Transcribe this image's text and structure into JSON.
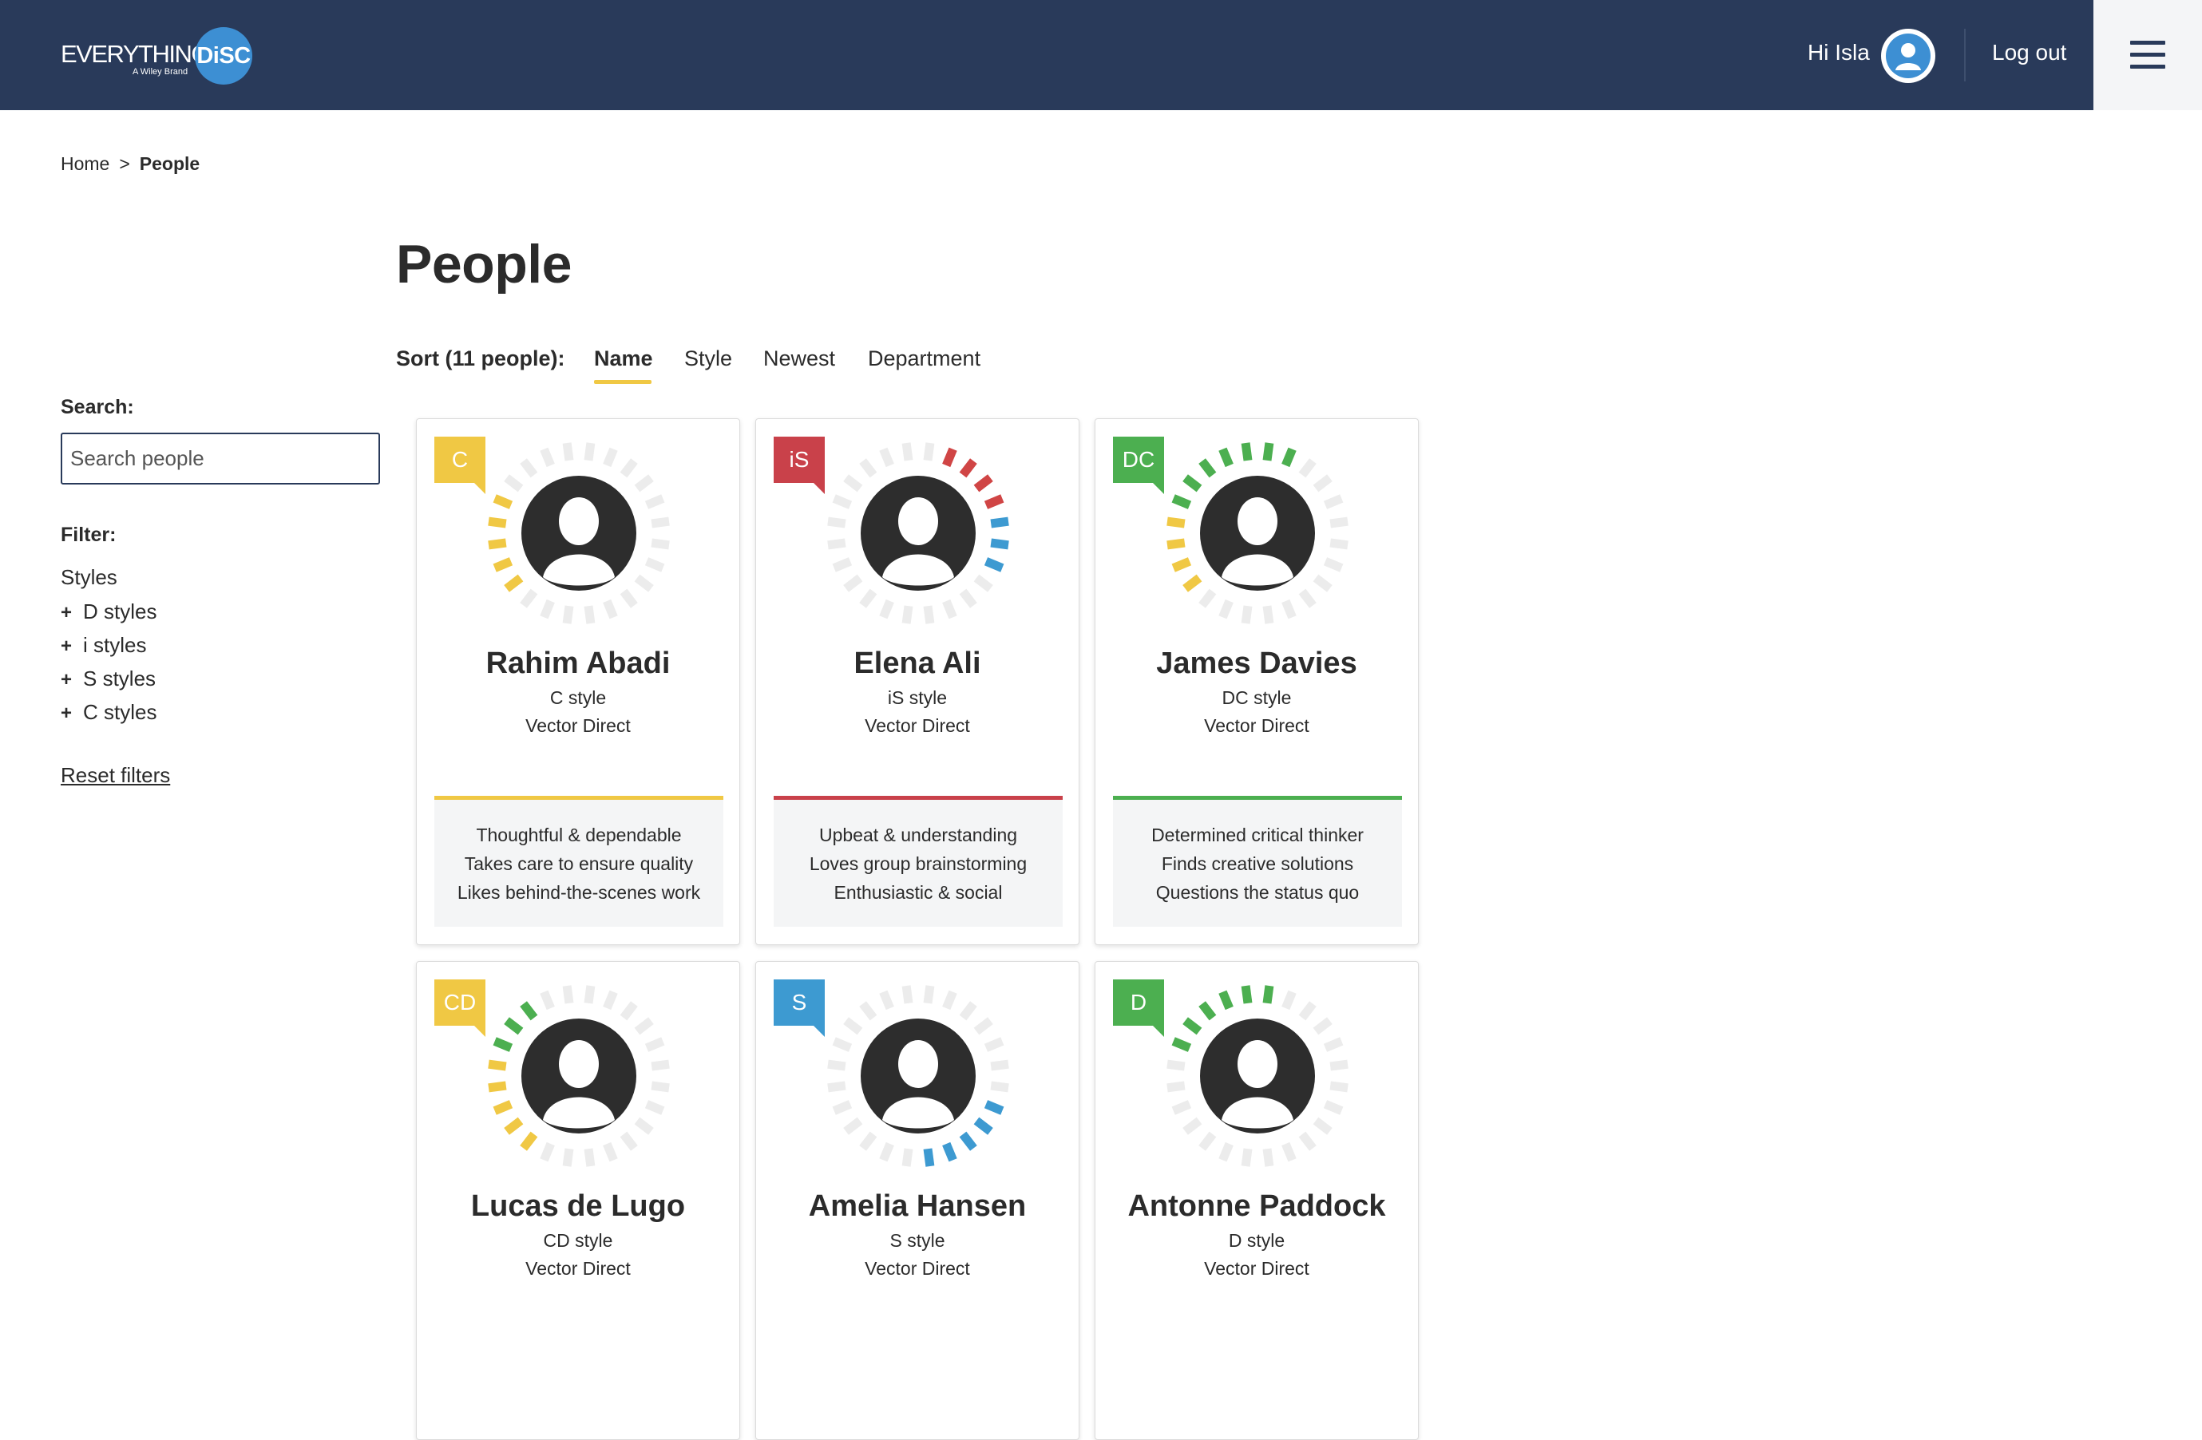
{
  "header": {
    "logo_text": "EVERYTHING",
    "logo_disc": "DiSC",
    "logo_sub": "A Wiley Brand",
    "greeting": "Hi Isla",
    "logout_label": "Log out",
    "colors": {
      "bar": "#293a5a",
      "accent": "#3d8fd3"
    }
  },
  "breadcrumb": {
    "home": "Home",
    "separator": ">",
    "current": "People"
  },
  "sidebar": {
    "search_label": "Search:",
    "search_placeholder": "Search people",
    "filter_label": "Filter:",
    "styles_heading": "Styles",
    "filters": [
      {
        "label": "D styles"
      },
      {
        "label": "i styles"
      },
      {
        "label": "S styles"
      },
      {
        "label": "C styles"
      }
    ],
    "reset_label": "Reset filters"
  },
  "main": {
    "title": "People",
    "sort_label": "Sort (11 people):",
    "sort_tabs": [
      {
        "label": "Name",
        "active": true
      },
      {
        "label": "Style",
        "active": false
      },
      {
        "label": "Newest",
        "active": false
      },
      {
        "label": "Department",
        "active": false
      }
    ]
  },
  "style_colors": {
    "D": "#4caf50",
    "i": "#d04545",
    "S": "#3d9ad1",
    "C": "#f0c844"
  },
  "people": [
    {
      "badge": "C",
      "badge_color": "#f0c844",
      "name": "Rahim Abadi",
      "style": "C style",
      "department": "Vector Direct",
      "traits": [
        "Thoughtful & dependable",
        "Takes care to ensure quality",
        "Likes behind-the-scenes work"
      ],
      "accent": "#f0c844"
    },
    {
      "badge": "iS",
      "badge_color": "#c9414a",
      "name": "Elena Ali",
      "style": "iS style",
      "department": "Vector Direct",
      "traits": [
        "Upbeat & understanding",
        "Loves group brainstorming",
        "Enthusiastic & social"
      ],
      "accent": "#c9414a"
    },
    {
      "badge": "DC",
      "badge_color": "#4caf50",
      "name": "James Davies",
      "style": "DC style",
      "department": "Vector Direct",
      "traits": [
        "Determined critical thinker",
        "Finds creative solutions",
        "Questions the status quo"
      ],
      "accent": "#4caf50"
    },
    {
      "badge": "CD",
      "badge_color": "#f0c844",
      "name": "Lucas de Lugo",
      "style": "CD style",
      "department": "Vector Direct",
      "traits": [],
      "accent": "#f0c844"
    },
    {
      "badge": "S",
      "badge_color": "#3d9ad1",
      "name": "Amelia Hansen",
      "style": "S style",
      "department": "Vector Direct",
      "traits": [],
      "accent": "#3d9ad1"
    },
    {
      "badge": "D",
      "badge_color": "#4caf50",
      "name": "Antonne Paddock",
      "style": "D style",
      "department": "Vector Direct",
      "traits": [],
      "accent": "#4caf50"
    }
  ]
}
